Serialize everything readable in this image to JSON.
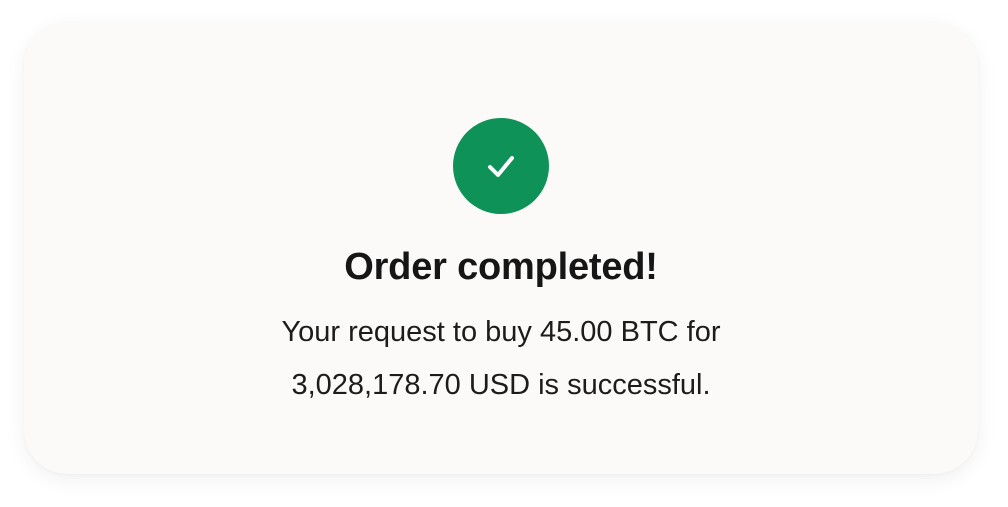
{
  "dialog": {
    "status_icon": "check-icon",
    "title": "Order completed!",
    "message": "Your request to buy 45.00 BTC for 3,028,178.70 USD is successful."
  },
  "colors": {
    "success": "#0f9258",
    "card_background": "#fbfaf8",
    "text": "#161616"
  }
}
